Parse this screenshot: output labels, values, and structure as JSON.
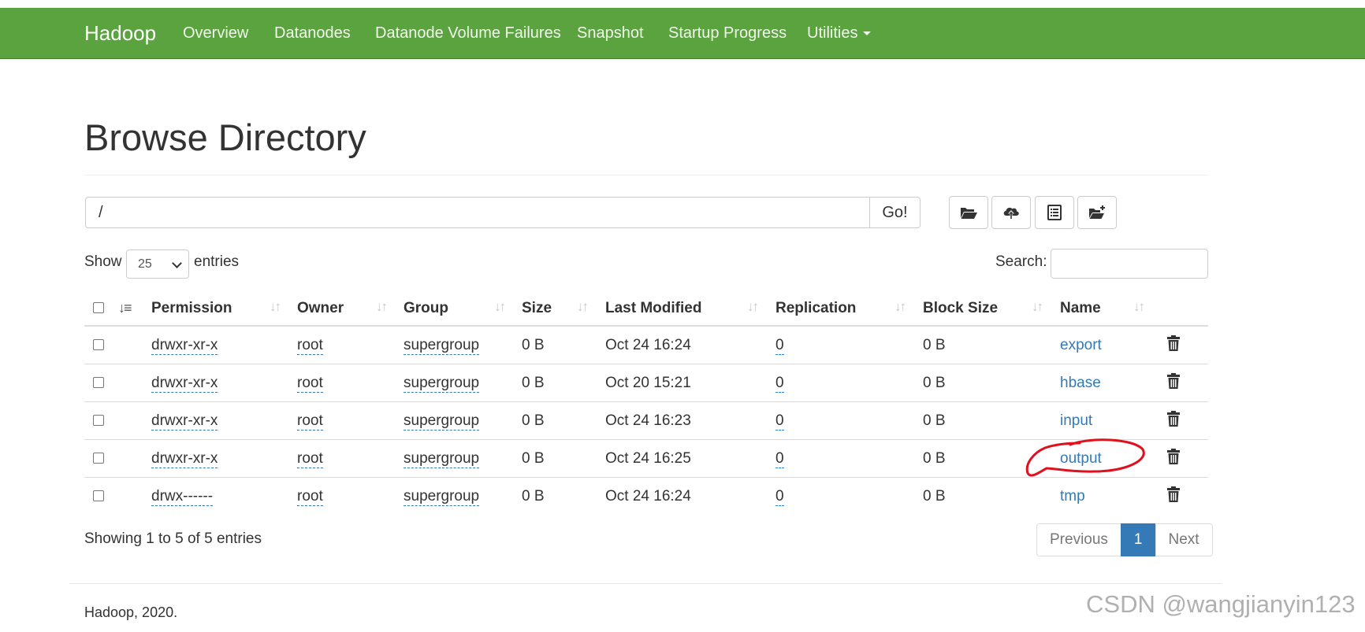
{
  "navbar": {
    "brand": "Hadoop",
    "items": [
      "Overview",
      "Datanodes",
      "Datanode Volume Failures",
      "Snapshot",
      "Startup Progress",
      "Utilities"
    ]
  },
  "page": {
    "title": "Browse Directory"
  },
  "path_bar": {
    "value": "/",
    "go_label": "Go!"
  },
  "toolbar": {
    "icons": [
      "folder-open-icon",
      "cloud-upload-icon",
      "list-alt-icon",
      "folder-new-icon"
    ]
  },
  "controls": {
    "show_label": "Show",
    "entries_label": "entries",
    "page_length": "25",
    "search_label": "Search:"
  },
  "table": {
    "headers": [
      "Permission",
      "Owner",
      "Group",
      "Size",
      "Last Modified",
      "Replication",
      "Block Size",
      "Name"
    ],
    "rows": [
      {
        "permission": "drwxr-xr-x",
        "owner": "root",
        "group": "supergroup",
        "size": "0 B",
        "modified": "Oct 24 16:24",
        "replication": "0",
        "block_size": "0 B",
        "name": "export"
      },
      {
        "permission": "drwxr-xr-x",
        "owner": "root",
        "group": "supergroup",
        "size": "0 B",
        "modified": "Oct 20 15:21",
        "replication": "0",
        "block_size": "0 B",
        "name": "hbase"
      },
      {
        "permission": "drwxr-xr-x",
        "owner": "root",
        "group": "supergroup",
        "size": "0 B",
        "modified": "Oct 24 16:23",
        "replication": "0",
        "block_size": "0 B",
        "name": "input"
      },
      {
        "permission": "drwxr-xr-x",
        "owner": "root",
        "group": "supergroup",
        "size": "0 B",
        "modified": "Oct 24 16:25",
        "replication": "0",
        "block_size": "0 B",
        "name": "output"
      },
      {
        "permission": "drwx------",
        "owner": "root",
        "group": "supergroup",
        "size": "0 B",
        "modified": "Oct 24 16:24",
        "replication": "0",
        "block_size": "0 B",
        "name": "tmp"
      }
    ]
  },
  "table_info": "Showing 1 to 5 of 5 entries",
  "pagination": {
    "previous": "Previous",
    "current": "1",
    "next": "Next"
  },
  "footer": "Hadoop, 2020.",
  "watermark": "CSDN @wangjianyin123",
  "colors": {
    "navbar": "#5aa33e",
    "link": "#337ab7",
    "annotation": "#e0101e"
  }
}
